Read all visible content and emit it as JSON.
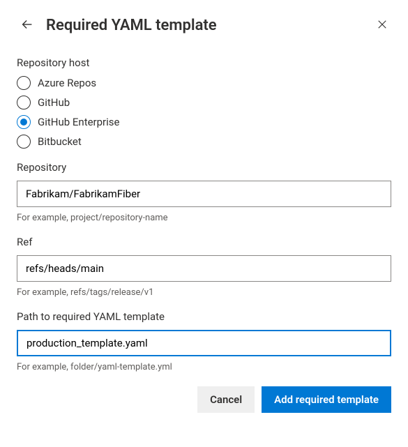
{
  "header": {
    "title": "Required YAML template"
  },
  "repositoryHost": {
    "label": "Repository host",
    "options": [
      {
        "label": "Azure Repos",
        "selected": false
      },
      {
        "label": "GitHub",
        "selected": false
      },
      {
        "label": "GitHub Enterprise",
        "selected": true
      },
      {
        "label": "Bitbucket",
        "selected": false
      }
    ]
  },
  "repository": {
    "label": "Repository",
    "value": "Fabrikam/FabrikamFiber",
    "help": "For example, project/repository-name"
  },
  "ref": {
    "label": "Ref",
    "value": "refs/heads/main",
    "help": "For example, refs/tags/release/v1"
  },
  "path": {
    "label": "Path to required YAML template",
    "value": "production_template.yaml",
    "help": "For example, folder/yaml-template.yml"
  },
  "footer": {
    "cancel": "Cancel",
    "submit": "Add required template"
  }
}
